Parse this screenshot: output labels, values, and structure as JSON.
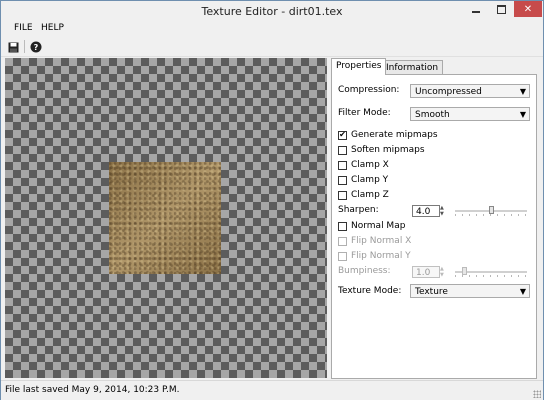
{
  "window": {
    "title": "Texture Editor - dirt01.tex"
  },
  "menu": {
    "file": "FILE",
    "help": "HELP"
  },
  "toolbar": {
    "save_icon": "save-icon",
    "help_icon": "help-icon"
  },
  "tabs": [
    {
      "label": "Properties",
      "active": true
    },
    {
      "label": "Information",
      "active": false
    }
  ],
  "properties": {
    "compression": {
      "label": "Compression:",
      "value": "Uncompressed"
    },
    "filter_mode": {
      "label": "Filter Mode:",
      "value": "Smooth"
    },
    "checkboxes": [
      {
        "label": "Generate mipmaps",
        "checked": true,
        "enabled": true
      },
      {
        "label": "Soften mipmaps",
        "checked": false,
        "enabled": true
      },
      {
        "label": "Clamp X",
        "checked": false,
        "enabled": true
      },
      {
        "label": "Clamp Y",
        "checked": false,
        "enabled": true
      },
      {
        "label": "Clamp Z",
        "checked": false,
        "enabled": true
      }
    ],
    "sharpen": {
      "label": "Sharpen:",
      "value": "4.0",
      "slider_level": 0.5
    },
    "normal_map": {
      "label": "Normal Map",
      "checked": false
    },
    "flip_normal_x": {
      "label": "Flip Normal X",
      "checked": false,
      "enabled": false
    },
    "flip_normal_y": {
      "label": "Flip Normal Y",
      "checked": false,
      "enabled": false
    },
    "bumpiness": {
      "label": "Bumpiness:",
      "value": "1.0",
      "enabled": false,
      "slider_level": 0.1
    },
    "texture_mode": {
      "label": "Texture Mode:",
      "value": "Texture"
    }
  },
  "status": {
    "text": "File last saved May 9, 2014, 10:23 P.M."
  }
}
